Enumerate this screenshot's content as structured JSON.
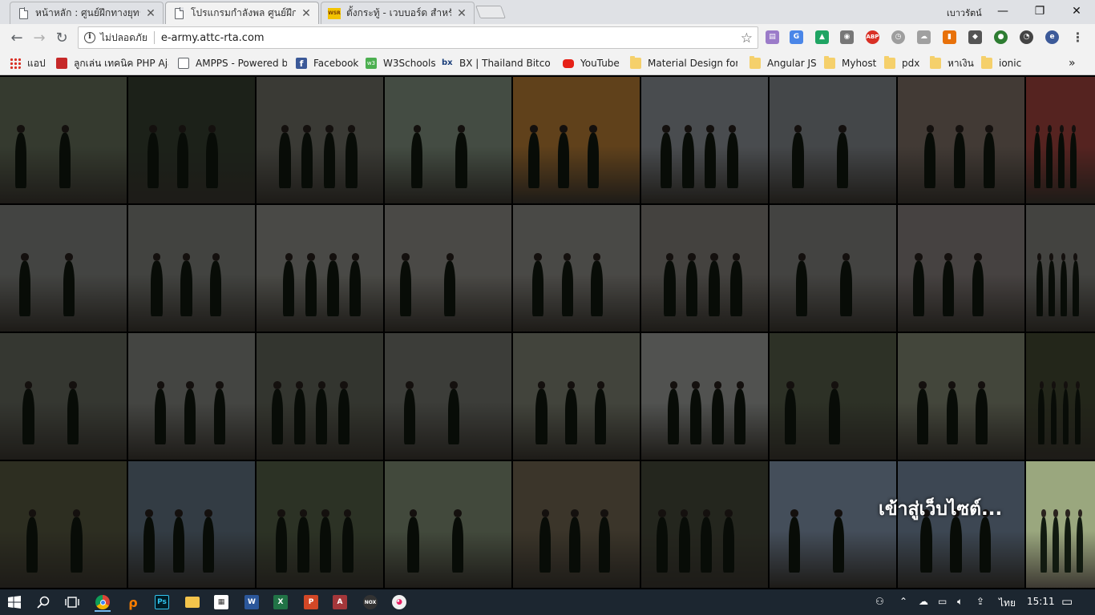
{
  "tabs": [
    {
      "title": "หน้าหลัก : ศูนย์ฝึกทางยุทธวิธี",
      "icon": "document-icon",
      "active": false
    },
    {
      "title": "โปรแกรมกำลังพล ศูนย์ฝึกทาง",
      "icon": "document-icon",
      "active": true
    },
    {
      "title": "ตั้งกระทู้ - เวบบอร์ด สำหรับ",
      "icon": "wsr-icon",
      "active": false
    }
  ],
  "window": {
    "user": "เบาวรัตน์",
    "minimize": "—",
    "maximize": "❐",
    "close": "✕"
  },
  "omnibox": {
    "security_label": "ไม่ปลอดภัย",
    "url": "e-army.attc-rta.com"
  },
  "bookmarks": [
    {
      "label": "แอป",
      "icon": "apps-icon"
    },
    {
      "label": "ลูกเล่น เทคนิค PHP Ajax",
      "icon": "site-icon"
    },
    {
      "label": "AMPPS - Powered by",
      "icon": "document-icon"
    },
    {
      "label": "Facebook",
      "icon": "facebook-icon"
    },
    {
      "label": "W3Schools",
      "icon": "w3schools-icon"
    },
    {
      "label": "BX | Thailand Bitcoin",
      "icon": "bx-icon"
    },
    {
      "label": "YouTube",
      "icon": "youtube-icon"
    },
    {
      "label": "Material Design for B",
      "icon": "folder-icon"
    },
    {
      "label": "Angular JS",
      "icon": "folder-icon"
    },
    {
      "label": "Myhost",
      "icon": "folder-icon"
    },
    {
      "label": "pdx",
      "icon": "folder-icon"
    },
    {
      "label": "หาเงิน",
      "icon": "folder-icon"
    },
    {
      "label": "ionic",
      "icon": "folder-icon"
    }
  ],
  "bookmarks_more": "»",
  "gallery": {
    "enter_label": "เข้าสู่เว็บไซต์...",
    "tile_colors": [
      "#6f7a63",
      "#3b4636",
      "#7a7a70",
      "#8ea08c",
      "#c8883a",
      "#9aa0a6",
      "#8f9499",
      "#8a7a70",
      "#b24a44",
      "#8d8f8a",
      "#8a8c86",
      "#9a9a92",
      "#9c9a93",
      "#9a9892",
      "#8e8a84",
      "#8d8c88",
      "#938a88",
      "#8c8c86",
      "#6f7367",
      "#8f918b",
      "#6c7062",
      "#7d7f77",
      "#8b8f7e",
      "#a9aca8",
      "#5e6650",
      "#8d927c",
      "#4a5037",
      "#5f6046",
      "#6b7e8f",
      "#5d6a4e",
      "#8b9a7e",
      "#7b6f58",
      "#4d5140",
      "#8fa3bd",
      "#7f95ae",
      "#9aa77e"
    ]
  },
  "taskbar": {
    "language": "ไทย",
    "time": "15:11"
  }
}
